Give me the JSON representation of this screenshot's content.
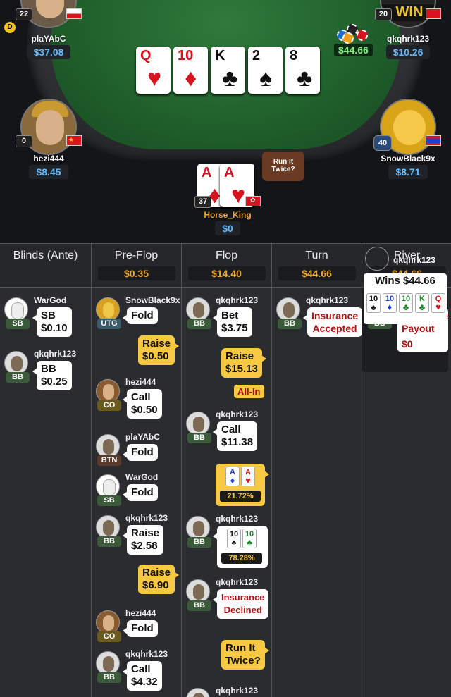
{
  "table": {
    "pot": "$44.66",
    "board": [
      {
        "rank": "Q",
        "suit": "♥",
        "color": "red"
      },
      {
        "rank": "10",
        "suit": "♦",
        "color": "red"
      },
      {
        "rank": "K",
        "suit": "♣",
        "color": "blk"
      },
      {
        "rank": "2",
        "suit": "♠",
        "color": "blk"
      },
      {
        "rank": "8",
        "suit": "♣",
        "color": "blk"
      }
    ],
    "players": {
      "top_left": {
        "name": "plaYAbC",
        "stack": "$37.08",
        "level": "22",
        "dealer": "D"
      },
      "top_right": {
        "name": "qkqhrk123",
        "stack": "$10.26",
        "level": "20",
        "banner": "WIN"
      },
      "left": {
        "name": "hezi444",
        "stack": "$8.45",
        "level": "0"
      },
      "right": {
        "name": "SnowBlack9x",
        "stack": "$8.71",
        "level": "40"
      },
      "hero": {
        "name": "Horse_King",
        "stack": "$0",
        "level": "37",
        "cards": [
          {
            "rank": "A",
            "suit": "♦"
          },
          {
            "rank": "A",
            "suit": "♥"
          }
        ]
      }
    },
    "run_it_twice_bubble": "Run It\nTwice?"
  },
  "history": {
    "columns": [
      {
        "title": "Blinds (Ante)",
        "amount": ""
      },
      {
        "title": "Pre-Flop",
        "amount": "$0.35"
      },
      {
        "title": "Flop",
        "amount": "$14.40"
      },
      {
        "title": "Turn",
        "amount": "$44.66"
      },
      {
        "title": "River",
        "amount": "$44.66"
      }
    ],
    "blinds": [
      {
        "name": "WarGod",
        "pos": "SB",
        "action": "SB\n$0.10"
      },
      {
        "name": "qkqhrk123",
        "pos": "BB",
        "action": "BB\n$0.25"
      }
    ],
    "preflop": [
      {
        "name": "SnowBlack9x",
        "pos": "UTG",
        "action": "Fold"
      },
      {
        "raise": "Raise\n$0.50"
      },
      {
        "name": "hezi444",
        "pos": "CO",
        "action": "Call\n$0.50"
      },
      {
        "name": "plaYAbC",
        "pos": "BTN",
        "action": "Fold"
      },
      {
        "name": "WarGod",
        "pos": "SB",
        "action": "Fold"
      },
      {
        "name": "qkqhrk123",
        "pos": "BB",
        "action": "Raise\n$2.58"
      },
      {
        "raise": "Raise\n$6.90"
      },
      {
        "name": "hezi444",
        "pos": "CO",
        "action": "Fold"
      },
      {
        "name": "qkqhrk123",
        "pos": "BB",
        "action": "Call\n$4.32"
      }
    ],
    "flop": [
      {
        "name": "qkqhrk123",
        "pos": "BB",
        "action": "Bet\n$3.75"
      },
      {
        "raise": "Raise\n$15.13",
        "allin": "All-In"
      },
      {
        "name": "qkqhrk123",
        "pos": "BB",
        "action": "Call\n$11.38"
      },
      {
        "hero_equity": "21.72%",
        "cards": [
          {
            "rank": "A",
            "suit": "♦"
          },
          {
            "rank": "A",
            "suit": "♥"
          }
        ]
      },
      {
        "name": "qkqhrk123",
        "pos": "BB",
        "equity": "78.28%",
        "cards": [
          {
            "rank": "10",
            "suit": "♠"
          },
          {
            "rank": "10",
            "suit": "♣"
          }
        ]
      },
      {
        "name": "qkqhrk123",
        "pos": "BB",
        "action": "Insurance\nDeclined"
      },
      {
        "raise": "Run It\nTwice?"
      },
      {
        "name": "qkqhrk123"
      }
    ],
    "turn": [
      {
        "name": "qkqhrk123",
        "pos": "BB",
        "action": "Insurance\nAccepted"
      }
    ],
    "river": [
      {
        "name": "qkqhrk123",
        "pos": "BB",
        "action": "Insurance\nPayout",
        "amount": "$0"
      },
      {
        "name": "qkqhrk123",
        "wins": "Wins $44.66",
        "cards": [
          {
            "rank": "10",
            "suit": "♠"
          },
          {
            "rank": "10",
            "suit": "♦"
          },
          {
            "rank": "10",
            "suit": "♣"
          },
          {
            "rank": "K",
            "suit": "♣"
          },
          {
            "rank": "Q",
            "suit": "♥"
          }
        ]
      }
    ]
  }
}
